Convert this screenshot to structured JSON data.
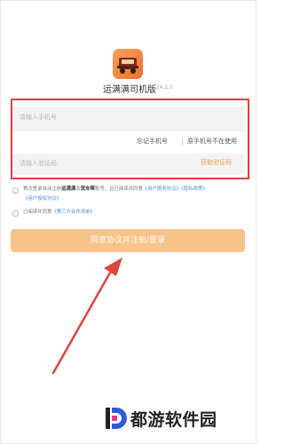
{
  "app": {
    "name": "运满满司机版",
    "version": "8.24.2.0",
    "icon": "truck-app-icon"
  },
  "login": {
    "phone_placeholder": "请输入手机号",
    "forgot_phone": "忘记手机号",
    "phone_not_in_use": "原手机号不在使用",
    "code_placeholder": "请输入验证码",
    "get_code": "获取验证码"
  },
  "agreements": {
    "line1": {
      "prefix": "首次登录自动注册",
      "brand1": "运满满",
      "and": "及",
      "brand2": "货车帮",
      "middle": "账号，且已阅读并同意",
      "link1": "《用户服务协议》",
      "link2": "《隐私政策》",
      "link3": "《用户授权协议》"
    },
    "line2": {
      "prefix": "已阅读并同意",
      "link": "《第三方合作清单》"
    }
  },
  "submit_label": "同意协议并注册/登录",
  "watermark": "都游软件园",
  "colors": {
    "accent": "#f49b45",
    "highlight_box": "#e73c3c",
    "arrow": "#e0443c",
    "link": "#4a90e2",
    "button": "#f7c389"
  }
}
